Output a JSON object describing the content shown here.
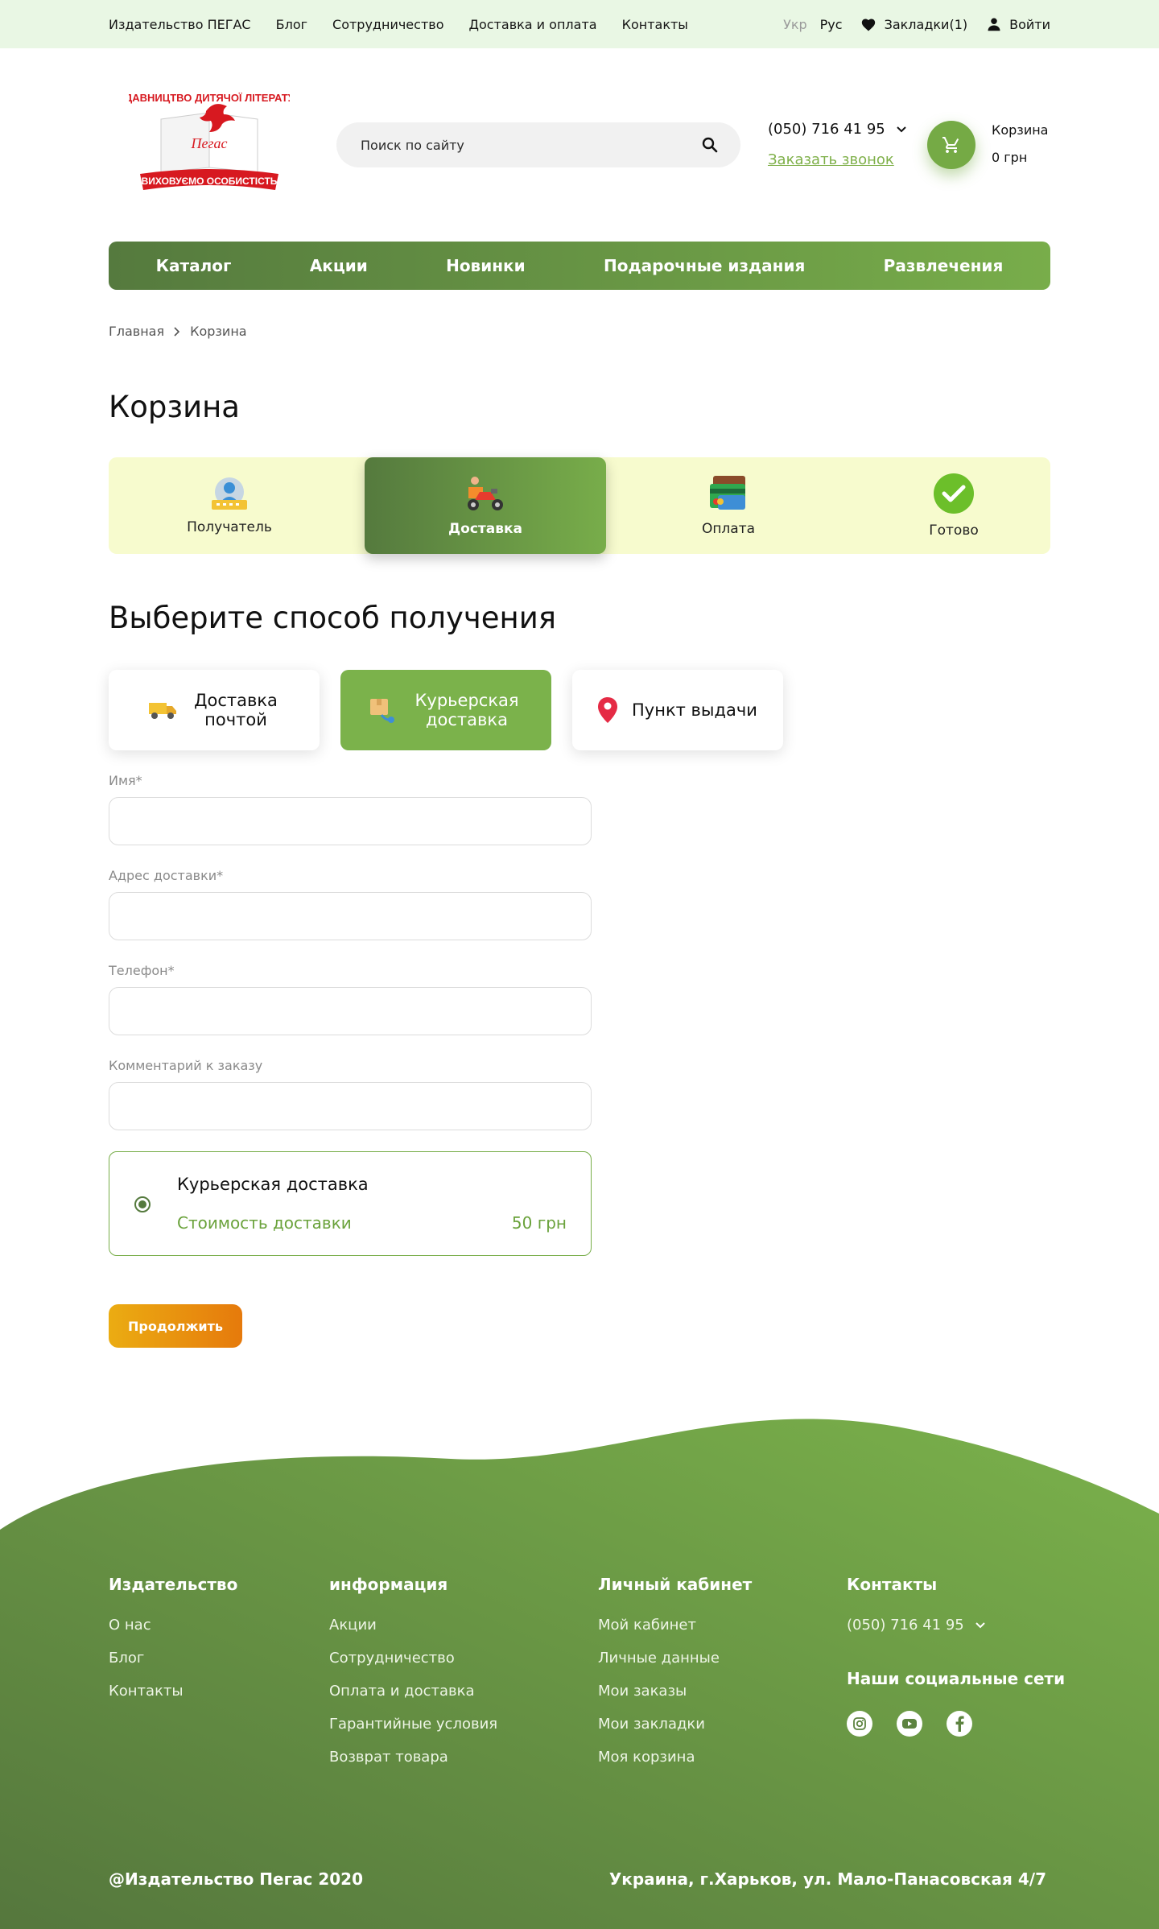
{
  "topbar": {
    "links": [
      "Издательство ПЕГАС",
      "Блог",
      "Сотрудничество",
      "Доставка и оплата",
      "Контакты"
    ],
    "lang_inactive": "Укр",
    "lang_active": "Рус",
    "bookmarks": "Закладки(1)",
    "login": "Войти"
  },
  "header": {
    "logo_text": {
      "top": "ВИДАВНИЦТВО ДИТЯЧОЇ ЛІТЕРАТУРИ",
      "brand": "Пегас",
      "bottom": "ВИХОВУЄМО ОСОБИСТІСТЬ"
    },
    "search_placeholder": "Поиск по сайту",
    "phone": "(050) 716 41 95",
    "callback": "Заказать звонок",
    "cart_label": "Корзина",
    "cart_sum": "0 грн"
  },
  "mainnav": [
    "Каталог",
    "Акции",
    "Новинки",
    "Подарочные издания",
    "Развлечения"
  ],
  "breadcrumb": [
    "Главная",
    "Корзина"
  ],
  "page_title": "Корзина",
  "steps": [
    {
      "label": "Получатель",
      "icon": "recipient-icon",
      "active": false
    },
    {
      "label": "Доставка",
      "icon": "delivery-scooter-icon",
      "active": true
    },
    {
      "label": "Оплата",
      "icon": "payment-cards-icon",
      "active": false
    },
    {
      "label": "Готово",
      "icon": "check-circle-icon",
      "active": false
    }
  ],
  "section_title": "Выберите способ получения",
  "delivery_options": [
    {
      "label": "Доставка почтой",
      "icon": "truck-icon",
      "selected": false
    },
    {
      "label": "Курьерская доставка",
      "icon": "courier-box-icon",
      "selected": true
    },
    {
      "label": "Пункт выдачи",
      "icon": "location-pin-icon",
      "selected": false
    }
  ],
  "form": {
    "name_label": "Имя*",
    "name_value": "",
    "address_label": "Адрес доставки*",
    "address_value": "",
    "phone_label": "Телефон*",
    "phone_value": "",
    "comment_label": "Комментарий к заказу",
    "comment_value": ""
  },
  "shipping": {
    "title": "Курьерская доставка",
    "cost_label": "Стоимость доставки",
    "cost": "50 грн",
    "selected": true
  },
  "continue_label": "Продолжить",
  "footer": {
    "col1": {
      "title": "Издательство",
      "links": [
        "О нас",
        "Блог",
        "Контакты"
      ]
    },
    "col2": {
      "title": "информация",
      "links": [
        "Акции",
        "Сотрудничество",
        "Оплата и доставка",
        "Гарантийные условия",
        "Возврат товара"
      ]
    },
    "col3": {
      "title": "Личный кабинет",
      "links": [
        "Мой кабинет",
        "Личные данные",
        "Мои заказы",
        "Мои закладки",
        "Моя корзина"
      ]
    },
    "col4": {
      "title": "Контакты",
      "phone": "(050) 716 41 95",
      "social_title": "Наши социальные сети",
      "socials": [
        "instagram-icon",
        "youtube-icon",
        "facebook-icon"
      ]
    },
    "copyright": "@Издательство Пегас 2020",
    "address": "Украина,  г.Харьков, ул. Мало-Панасовская 4/7"
  },
  "colors": {
    "accent_green": "#75aa45",
    "dark_green": "#557a3e",
    "topbar_bg": "#e9f7e4",
    "steps_bg": "#f7fbce",
    "button_orange": "#e98a10",
    "logo_red": "#d71920"
  }
}
